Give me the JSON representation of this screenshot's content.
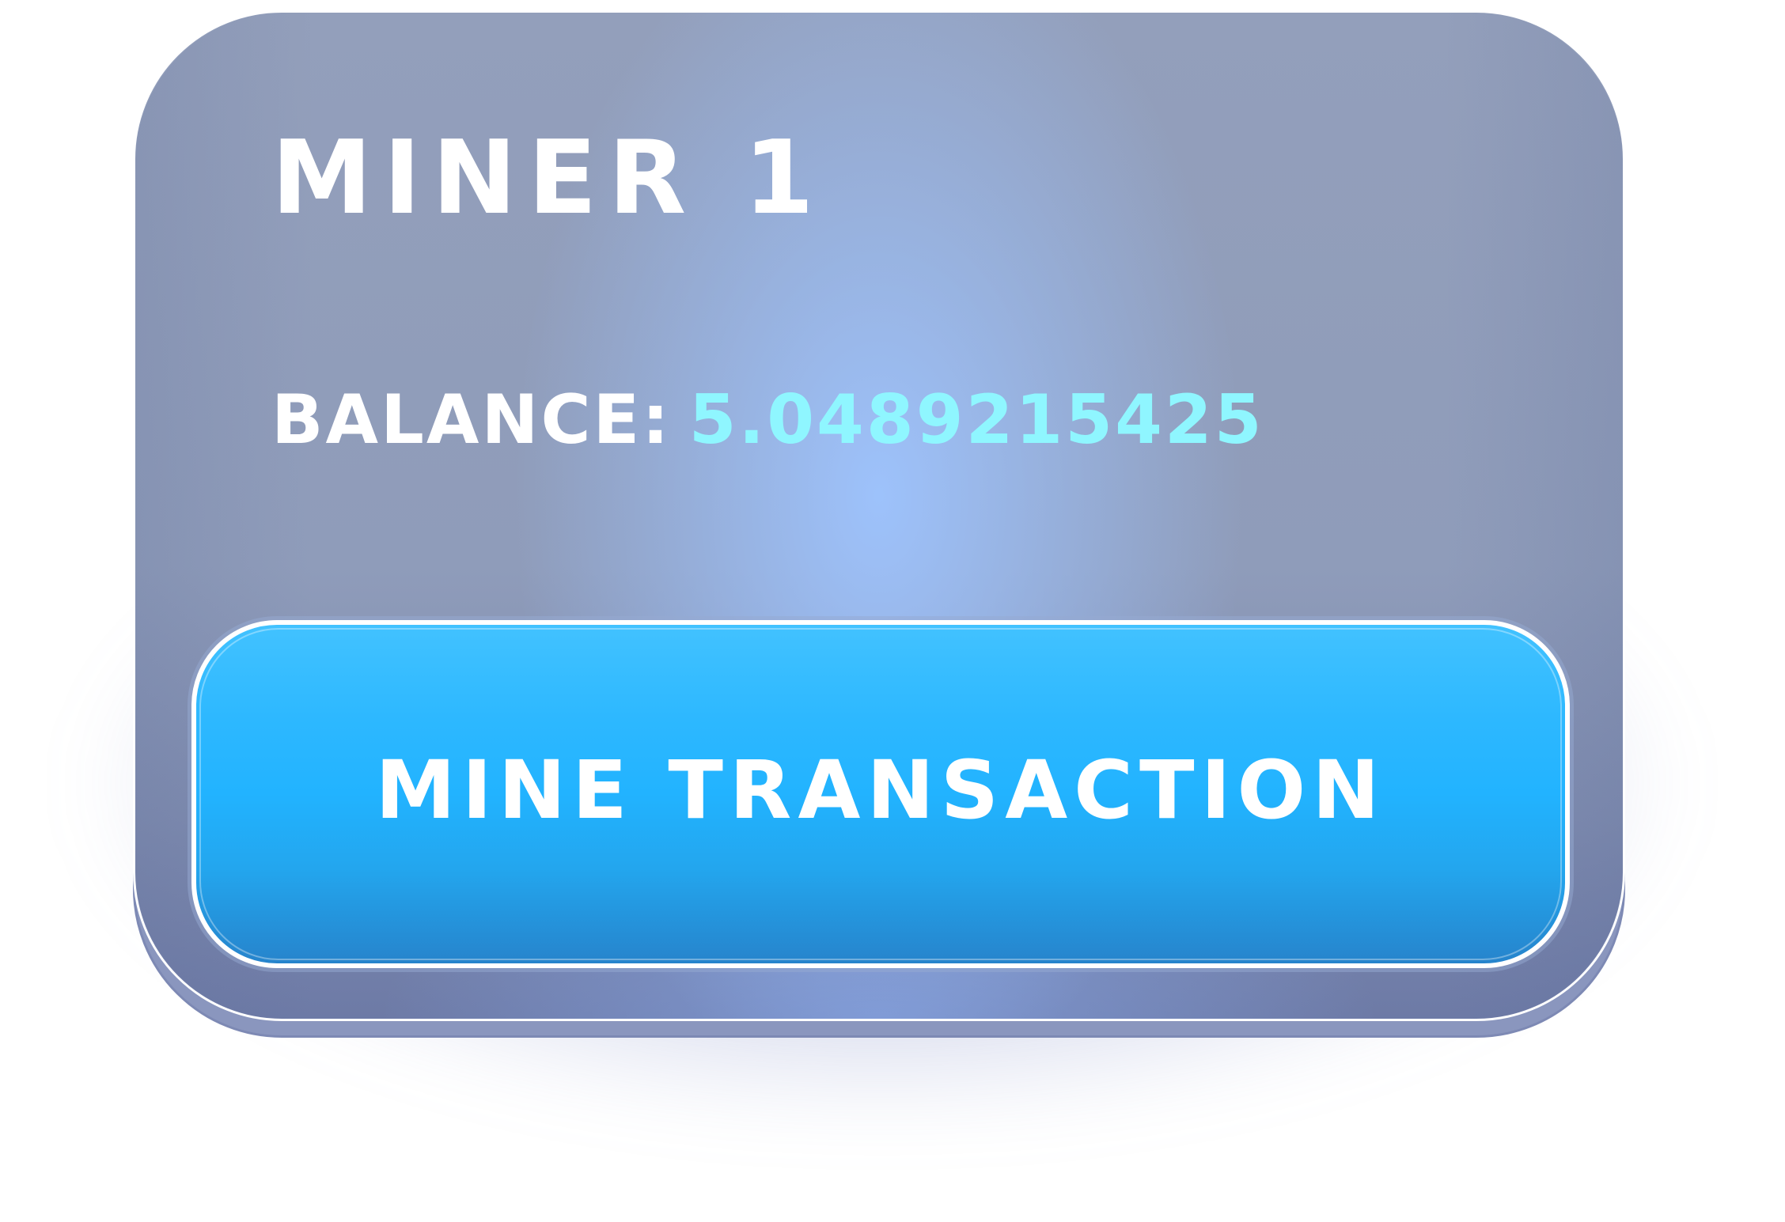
{
  "card": {
    "title": "MINER 1",
    "balance_label": "BALANCE:",
    "balance_value": "5.04892154 25"
  },
  "actions": {
    "mine_label": "MINE TRANSACTION"
  },
  "colors": {
    "card_background": "#939fbb",
    "card_highlight": "#9ec4ff",
    "balance_value": "#8ff6ff",
    "button_top": "#42c2ff",
    "button_bottom": "#2684cc",
    "text": "#ffffff"
  }
}
